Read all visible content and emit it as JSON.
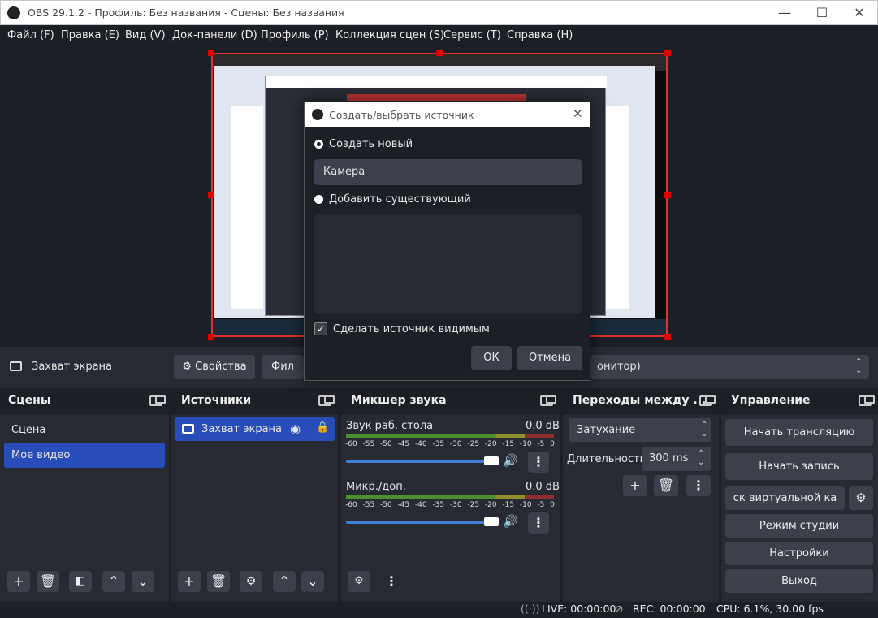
{
  "window": {
    "title": "OBS 29.1.2 - Профиль: Без названия - Сцены: Без названия",
    "minimize": "—",
    "maximize": "☐",
    "close": "✕"
  },
  "menu": [
    "Файл (F)",
    "Правка (E)",
    "Вид (V)",
    "Док-панели (D)",
    "Профиль (P)",
    "Коллекция сцен (S)",
    "Сервис (T)",
    "Справка (H)"
  ],
  "toolbar": {
    "source_name": "Захват экрана",
    "properties": "Свойства",
    "filters": "Фил",
    "display": "онитор)"
  },
  "scenes": {
    "title": "Сцены",
    "items": [
      "Сцена",
      "Мое видео"
    ],
    "selected": 1
  },
  "sources": {
    "title": "Источники",
    "items": [
      "Захват экрана"
    ]
  },
  "mixer": {
    "title": "Микшер звука",
    "channels": [
      {
        "name": "Звук раб. стола",
        "level": "0.0 dB"
      },
      {
        "name": "Микр./доп.",
        "level": "0.0 dB"
      }
    ],
    "scale": [
      "-60",
      "-55",
      "-50",
      "-45",
      "-40",
      "-35",
      "-30",
      "-25",
      "-20",
      "-15",
      "-10",
      "-5",
      "0"
    ]
  },
  "transitions": {
    "title": "Переходы между ...",
    "type": "Затухание",
    "duration_label": "Длительность",
    "duration": "300 ms"
  },
  "controls": {
    "title": "Управление",
    "start_stream": "Начать трансляцию",
    "start_record": "Начать запись",
    "virtual_cam": "ск виртуальной ка",
    "studio_mode": "Режим студии",
    "settings": "Настройки",
    "exit": "Выход"
  },
  "status": {
    "live": "LIVE: 00:00:00",
    "rec": "REC: 00:00:00",
    "cpu": "CPU: 6.1%, 30.00 fps"
  },
  "dialog": {
    "title": "Создать/выбрать источник",
    "create_new": "Создать новый",
    "name_value": "Камера",
    "add_existing": "Добавить существующий",
    "make_visible": "Сделать источник видимым",
    "ok": "ОК",
    "cancel": "Отмена"
  },
  "colors": {
    "accent": "#284cb8",
    "bg": "#1d1f26",
    "panel": "#272a33",
    "button": "#3c404b",
    "selection_border": "#e03030"
  }
}
